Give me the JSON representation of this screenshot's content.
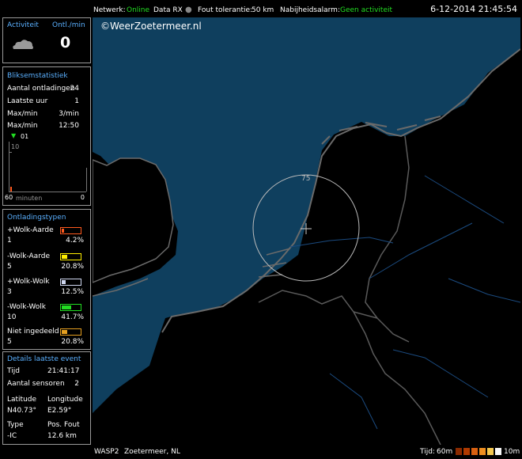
{
  "topbar": {
    "netwerk_label": "Netwerk:",
    "netwerk_value": "Online",
    "data_rx": "Data RX",
    "fout_label": "Fout tolerantie:",
    "fout_value": "50 km",
    "nabij_label": "Nabijheidsalarm:",
    "nabij_value": "Geen activiteit",
    "datetime": "6-12-2014 21:45:54"
  },
  "activity": {
    "title": "Activiteit",
    "rate_title": "Ontl./min",
    "rate_value": "0",
    "icon": "cloud-icon"
  },
  "stats": {
    "title": "Bliksemstatistiek",
    "rows": [
      {
        "label": "Aantal ontladingen",
        "value": "24"
      },
      {
        "label": "Laatste uur",
        "value": "1"
      },
      {
        "label": "Max/min",
        "value": "3/min"
      },
      {
        "label": "Max/min",
        "value": "12:50"
      }
    ],
    "graph_marker": "01",
    "graph_ymax": "10",
    "graph_left": "60",
    "graph_unit": "minuten",
    "graph_right": "0"
  },
  "types": {
    "title": "Ontladingstypen",
    "items": [
      {
        "label": "+Wolk-Aarde",
        "count": "1",
        "percent": "4.2%",
        "color": "#ff5a1e",
        "fill": 0.042
      },
      {
        "label": "-Wolk-Aarde",
        "count": "5",
        "percent": "20.8%",
        "color": "#ffee00",
        "fill": 0.208
      },
      {
        "label": "+Wolk-Wolk",
        "count": "3",
        "percent": "12.5%",
        "color": "#d0d8f0",
        "fill": 0.125
      },
      {
        "label": "-Wolk-Wolk",
        "count": "10",
        "percent": "41.7%",
        "color": "#22dd22",
        "fill": 0.417
      },
      {
        "label": "Niet ingedeeld",
        "count": "5",
        "percent": "20.8%",
        "color": "#e6a020",
        "fill": 0.208
      }
    ]
  },
  "details": {
    "title": "Details laatste event",
    "tijd_label": "Tijd",
    "tijd_value": "21:41:17",
    "sensoren_label": "Aantal sensoren",
    "sensoren_value": "2",
    "lat_label": "Latitude",
    "lat_value": "N40.73°",
    "lon_label": "Longitude",
    "lon_value": "E2.59°",
    "type_label": "Type",
    "type_value": "-IC",
    "pos_label": "Pos. Fout",
    "pos_value": "12.6 km"
  },
  "map": {
    "credit": "©WeerZoetermeer.nl",
    "circle_label": "75",
    "sea_color": "#0f3f5e"
  },
  "bottombar": {
    "station": "WASP2",
    "location": "Zoetermeer, NL",
    "tijd_label": "Tijd:",
    "tijd_left": "60m",
    "tijd_right": "10m",
    "scale_colors": [
      "#8b2a00",
      "#b03a00",
      "#d86010",
      "#ee8e20",
      "#f4c850",
      "#f8f8f8"
    ]
  }
}
